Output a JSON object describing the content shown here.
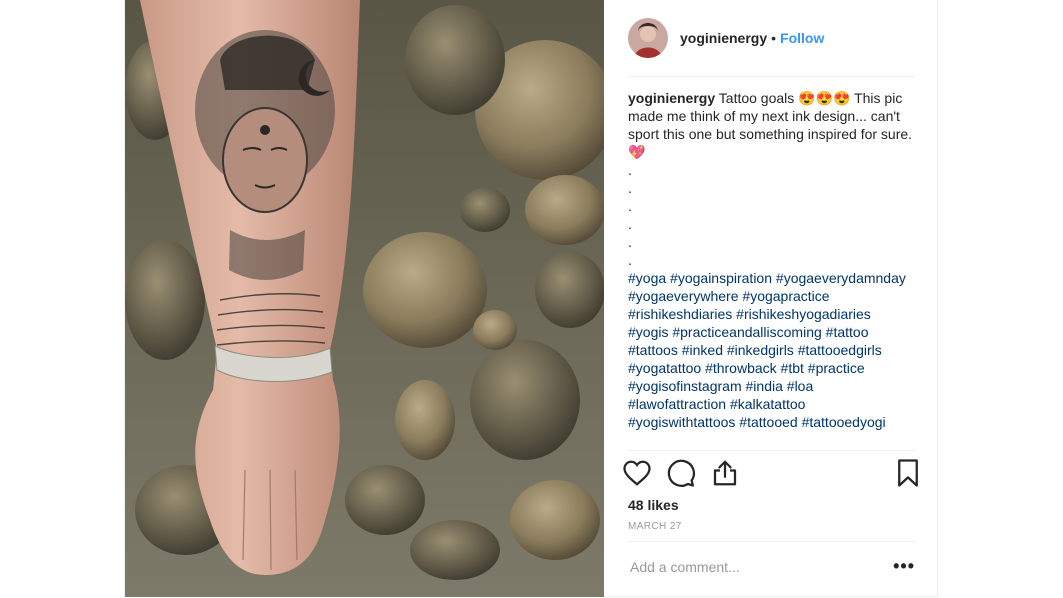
{
  "post": {
    "username": "yoginienergy",
    "follow_label": "Follow",
    "separator": "•",
    "caption": {
      "text": "Tattoo goals 😍😍😍 This pic made me think of my next ink design... can't sport this one but something inspired for sure. 💖",
      "dots": [
        ".",
        ".",
        ".",
        ".",
        ".",
        "."
      ],
      "hashtags": [
        "#yoga",
        "#yogainspiration",
        "#yogaeverydamnday",
        "#yogaeverywhere",
        "#yogapractice",
        "#rishikeshdiaries",
        "#rishikeshyogadiaries",
        "#yogis",
        "#practiceandalliscoming",
        "#tattoo",
        "#tattoos",
        "#inked",
        "#inkedgirls",
        "#tattooedgirls",
        "#yogatattoo",
        "#throwback",
        "#tbt",
        "#practice",
        "#yogisofinstagram",
        "#india",
        "#loa",
        "#lawofattraction",
        "#kalkatattoo",
        "#yogiswithtattoos",
        "#tattooed",
        "#tattooedyogi"
      ]
    },
    "likes": "48 likes",
    "date": "MARCH 27",
    "comment_placeholder": "Add a comment...",
    "more_label": "•••"
  },
  "icons": {
    "like": "heart-icon",
    "comment": "comment-icon",
    "share": "share-icon",
    "save": "bookmark-icon",
    "options": "more-options-icon"
  },
  "colors": {
    "follow": "#3897f0",
    "hashtag": "#003569",
    "meta": "#999999"
  }
}
